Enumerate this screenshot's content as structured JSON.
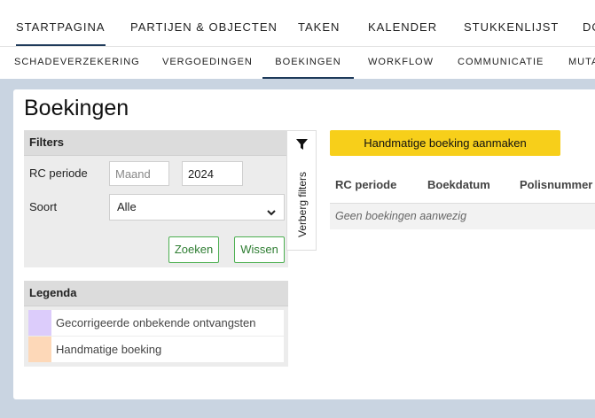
{
  "topnav": {
    "items": [
      "STARTPAGINA",
      "PARTIJEN & OBJECTEN",
      "TAKEN",
      "KALENDER",
      "STUKKENLIJST",
      "DO"
    ]
  },
  "subnav": {
    "items": [
      "SCHADEVERZEKERING",
      "VERGOEDINGEN",
      "BOEKINGEN",
      "WORKFLOW",
      "COMMUNICATIE",
      "MUTA"
    ]
  },
  "page": {
    "title": "Boekingen"
  },
  "filters": {
    "header": "Filters",
    "rc_periode_label": "RC periode",
    "month_placeholder": "Maand",
    "year_value": "2024",
    "soort_label": "Soort",
    "soort_value": "Alle",
    "search_label": "Zoeken",
    "clear_label": "Wissen",
    "toggle_label": "Verberg filters"
  },
  "legend": {
    "header": "Legenda",
    "items": [
      {
        "label": "Gecorrigeerde onbekende ontvangsten",
        "color": "#dcccfb"
      },
      {
        "label": "Handmatige boeking",
        "color": "#fdd8b8"
      }
    ]
  },
  "actions": {
    "create_manual_booking": "Handmatige boeking aanmaken"
  },
  "table": {
    "columns": [
      "RC periode",
      "Boekdatum",
      "Polisnummer"
    ],
    "empty_text": "Geen boekingen aanwezig"
  }
}
